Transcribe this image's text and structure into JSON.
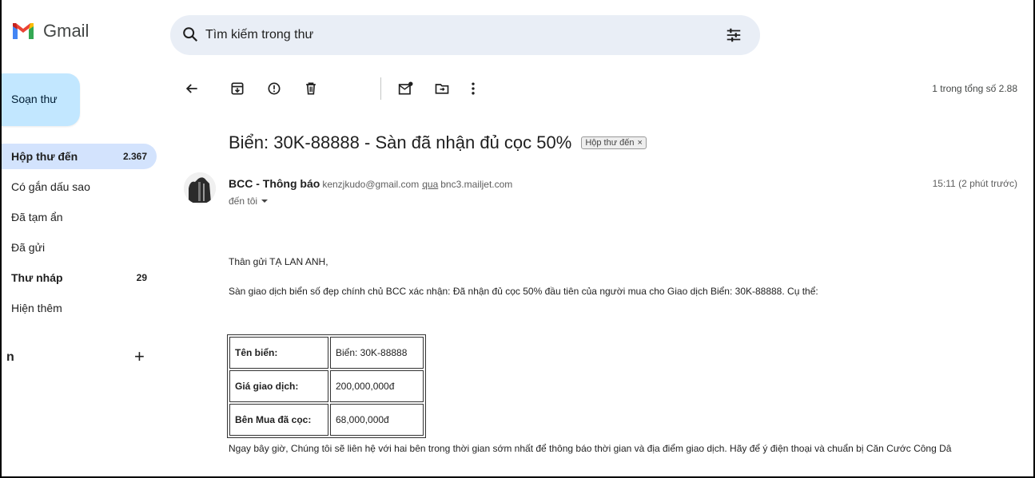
{
  "app": {
    "name": "Gmail"
  },
  "search": {
    "placeholder": "Tìm kiếm trong thư"
  },
  "sidebar": {
    "compose_label": "Soạn thư",
    "items": [
      {
        "label": "Hộp thư đến",
        "count": "2.367",
        "active": true,
        "bold": true
      },
      {
        "label": "Có gắn dấu sao",
        "count": ""
      },
      {
        "label": "Đã tạm ẩn",
        "count": ""
      },
      {
        "label": "Đã gửi",
        "count": ""
      },
      {
        "label": "Thư nháp",
        "count": "29",
        "bold": true
      },
      {
        "label": "Hiện thêm",
        "count": ""
      }
    ],
    "labels_heading": "n",
    "labels_add": "+"
  },
  "toolbar": {
    "icons": [
      "back-arrow-icon",
      "archive-icon",
      "report-spam-icon",
      "delete-icon",
      "mark-unread-icon",
      "move-to-icon",
      "more-vert-icon"
    ],
    "page_count": "1 trong tổng số 2.88"
  },
  "message": {
    "subject": "Biển: 30K-88888 - Sàn đã nhận đủ cọc 50%",
    "label_chip": "Hộp thư đến",
    "label_chip_close": "×",
    "sender_name": "BCC - Thông báo",
    "sender_email": "kenzjkudo@gmail.com",
    "via_word": "qua",
    "via_domain": "bnc3.mailjet.com",
    "to": "đến tôi",
    "time": "15:11 (2 phút trước)",
    "greeting": "Thân gửi TẠ LAN ANH,",
    "intro": "Sàn giao dịch biển số đẹp chính chủ BCC xác nhận: Đã nhận đủ cọc 50% đầu tiên của người mua cho Giao dịch Biển: 30K-88888. Cụ thể:",
    "details": [
      {
        "key": "Tên biển:",
        "value": "Biển: 30K-88888"
      },
      {
        "key": "Giá giao dịch:",
        "value": "200,000,000đ"
      },
      {
        "key": "Bên Mua đã cọc:",
        "value": "68,000,000đ"
      }
    ],
    "closing": "Ngay bây giờ, Chúng tôi sẽ liên hệ với hai bên trong thời gian sớm nhất để thông báo thời gian và địa điểm giao dịch. Hãy để ý điện thoại và chuẩn bị Căn Cước Công Dâ"
  },
  "colors": {
    "search_bg": "#e9eef6",
    "compose_bg": "#c2e7ff",
    "active_nav_bg": "#d3e3fd"
  }
}
